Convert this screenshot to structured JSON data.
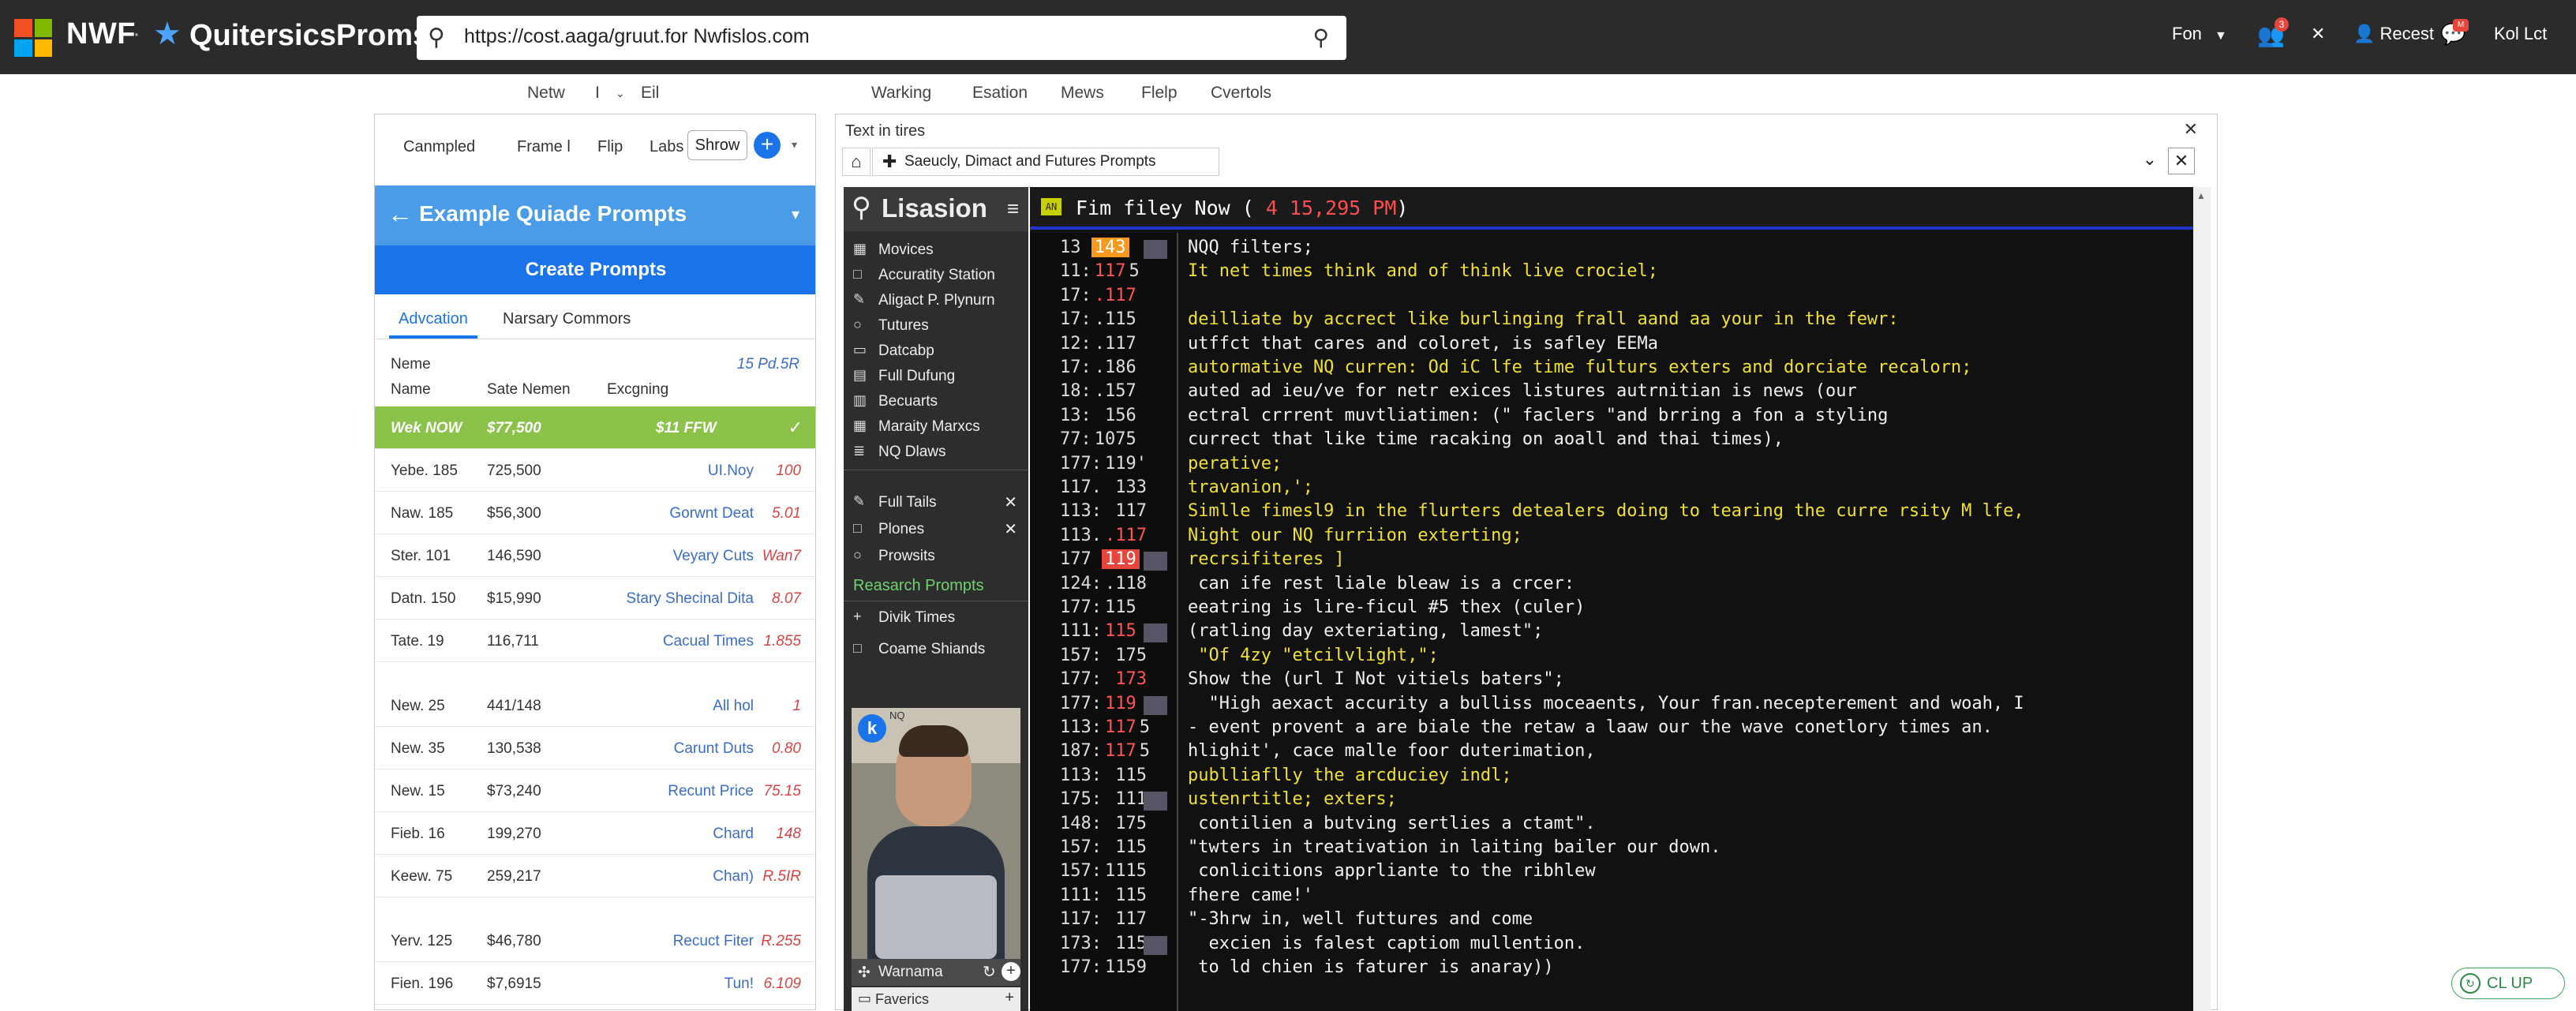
{
  "topbar": {
    "brand": "NWF",
    "separator": "·",
    "brand2": "QuitersicsProms",
    "url": "https://cost.aaga/gruut.for Nwfislos.com",
    "right_menu": "Fon",
    "notif_count": "3",
    "recent_label": "Recest",
    "msg_badge": "M",
    "user": "Kol Lct"
  },
  "navrow": {
    "left_items": [
      "Netw",
      "I",
      "Eil"
    ],
    "items": [
      "Warking",
      "Esation",
      "Mews",
      "Flelp",
      "Cvertols"
    ]
  },
  "left_panel": {
    "tools": [
      "Canmpled",
      "Frame l",
      "Flip",
      "Labs"
    ],
    "show_button": "Shrow",
    "header_title": "Example Quiade Prompts",
    "create_button": "Create Prompts",
    "tabs": [
      "Advcation",
      "Narsary Commors"
    ],
    "meta_label": "Neme",
    "meta_value": "15 Pd.5R",
    "columns": [
      "Name",
      "Sate Nemen",
      "Excgning"
    ],
    "highlight_row": {
      "c1": "Wek NOW",
      "c2": "$77,500",
      "c3": "$11 FFW"
    },
    "rows": [
      {
        "c1": "Yebe. 185",
        "c2": "725,500",
        "c3": "UI.Noy",
        "c4": "100"
      },
      {
        "c1": "Naw. 185",
        "c2": "$56,300",
        "c3": "Gorwnt Deat",
        "c4": "5.01"
      },
      {
        "c1": "Ster. 101",
        "c2": "146,590",
        "c3": "Veyary Cuts",
        "c4": "Wan7"
      },
      {
        "c1": "Datn. 150",
        "c2": "$15,990",
        "c3": "Stary Shecinal Dita",
        "c4": "8.07"
      },
      {
        "c1": "Tate. 19",
        "c2": "116,711",
        "c3": "Cacual Times",
        "c4": "1.855"
      },
      {
        "c1": "New. 25",
        "c2": "441/148",
        "c3": "All hol",
        "c4": "1"
      },
      {
        "c1": "New. 35",
        "c2": "130,538",
        "c3": "Carunt Duts",
        "c4": "0.80"
      },
      {
        "c1": "New. 15",
        "c2": "$73,240",
        "c3": "Recunt Price",
        "c4": "75.15"
      },
      {
        "c1": "Fieb. 16",
        "c2": "199,270",
        "c3": "Chard",
        "c4": "148"
      },
      {
        "c1": "Keew. 75",
        "c2": "259,217",
        "c3": "Chan)",
        "c4": "R.5IR"
      },
      {
        "c1": "Yerv. 125",
        "c2": "$46,780",
        "c3": "Recuct Fiter",
        "c4": "R.255"
      },
      {
        "c1": "Fien. 196",
        "c2": "$7,6915",
        "c3": "Tun!",
        "c4": "6.109"
      }
    ]
  },
  "right_window": {
    "title": "Text in tires",
    "tab_label": "Saeucly, Dimact and Futures  Prompts",
    "sidebar": {
      "title": "Lisasion",
      "items": [
        {
          "icon": "monitor-icon",
          "glyph": "▦",
          "label": "Movices"
        },
        {
          "icon": "box-icon",
          "glyph": "□",
          "label": "Accuratity Station"
        },
        {
          "icon": "pen-icon",
          "glyph": "✎",
          "label": "Aligact P. Plynurn"
        },
        {
          "icon": "circle-icon",
          "glyph": "○",
          "label": "Tutures"
        },
        {
          "icon": "clip-icon",
          "glyph": "▭",
          "label": "Datcabp"
        },
        {
          "icon": "film-icon",
          "glyph": "▤",
          "label": "Full Dufung"
        },
        {
          "icon": "doc-icon",
          "glyph": "▥",
          "label": "Becuarts"
        },
        {
          "icon": "grid-icon",
          "glyph": "▦",
          "label": "Maraity Marxcs"
        },
        {
          "icon": "list-icon",
          "glyph": "≣",
          "label": "NQ Dlaws"
        }
      ],
      "items2": [
        {
          "icon": "pen-icon",
          "glyph": "✎",
          "label": "Full Tails",
          "closable": true
        },
        {
          "icon": "box-icon",
          "glyph": "□",
          "label": "Plones",
          "closable": true
        },
        {
          "icon": "circle-icon",
          "glyph": "○",
          "label": "Prowsits",
          "closable": false
        }
      ],
      "section_label": "Reasarch Prompts",
      "items3": [
        {
          "icon": "plus-icon",
          "glyph": "+",
          "label": "Divik Times"
        },
        {
          "icon": "box-icon",
          "glyph": "□",
          "label": "Coame Shiands"
        }
      ],
      "video_badge": "k",
      "video_caption": "NQ",
      "bottom_label": "Warnama",
      "fav_label": "Faverics"
    },
    "terminal": {
      "title_main": "Fim filey Now ( ",
      "title_red": "4 15,295 PM",
      "title_end": ")",
      "lines": [
        {
          "n": "13 ",
          "tag": "143",
          "tagc": "orange",
          "code": "NQQ filters;",
          "y": false,
          "mark": true
        },
        {
          "n": "11:",
          "tag": "117",
          "tagc": "red",
          "tail": "5",
          "code": "It net times think and of think live crociel;",
          "y": true
        },
        {
          "n": "17:",
          "tag": ".117",
          "tagc": "red",
          "code": "",
          "y": false
        },
        {
          "n": "17:",
          "tag": ".115",
          "tagc": "",
          "code": "deilliate by accrect like burlinging frall aand aa your in the fewr:",
          "y": true
        },
        {
          "n": "12:",
          "tag": ".117",
          "tagc": "",
          "code": "utffct that cares and coloret, is safley EEMa",
          "y": false
        },
        {
          "n": "17:",
          "tag": ".186",
          "tagc": "",
          "code": "autormative NQ curren: Od iC lfe time fulturs exters and dorciate recalorn;",
          "y": true
        },
        {
          "n": "18:",
          "tag": ".157",
          "tagc": "",
          "code": "auted ad ieu/ve for netr exices listures autrnitian is news (our",
          "y": false
        },
        {
          "n": "13:",
          "tag": " 156",
          "tagc": "",
          "code": "ectral crrrent muvtliatimen: (\" faclers \"and brring a fon a styling",
          "y": false
        },
        {
          "n": "77:",
          "tag": "1075",
          "tagc": "",
          "code": "currect that like time racaking on aoall and thai times),",
          "y": false
        },
        {
          "n": "177:",
          "tag": "119'",
          "tagc": "",
          "code": "perative;",
          "y": true
        },
        {
          "n": "117.",
          "tag": " 133",
          "tagc": "",
          "code": "travanion,';",
          "y": true
        },
        {
          "n": "113:",
          "tag": " 117",
          "tagc": "",
          "code": "Simlle fimesl9 in the flurters detealers doing to tearing the curre rsity M lfe,",
          "y": true
        },
        {
          "n": "113.",
          "tag": ".117",
          "tagc": "red",
          "code": "Night our NQ furriion exterting;",
          "y": true
        },
        {
          "n": "177 ",
          "tag": "119",
          "tagc": "redbg",
          "code": "recrsifiteres ]",
          "y": true,
          "mark": true
        },
        {
          "n": "124:",
          "tag": ".118",
          "tagc": "",
          "code": " can ife rest liale bleaw is a crcer:",
          "y": false
        },
        {
          "n": "177:",
          "tag": "115",
          "tagc": "",
          "code": "eeatring is lire-ficul #5 thex (culer)",
          "y": false
        },
        {
          "n": "111:",
          "tag": "115",
          "tagc": "red",
          "code": "(ratling day exteriating, lamest\";",
          "y": false,
          "mark": true
        },
        {
          "n": "157:",
          "tag": " 175",
          "tagc": "",
          "code": " \"Of 4zy \"etcilvlight,\";",
          "y": true
        },
        {
          "n": "177:",
          "tag": " 173",
          "tagc": "red",
          "code": "Show the (url I Not vitiels baters\";",
          "y": false
        },
        {
          "n": "177:",
          "tag": "119",
          "tagc": "red",
          "code": "  \"High aexact accurity a bulliss moceaents, Your fran.necepterement and woah, I",
          "y": false,
          "mark": true
        },
        {
          "n": "113:",
          "tag": "117",
          "tagc": "red",
          "tail": "5",
          "code": "- event provent a are biale the retaw a laaw our the wave conetlory times an.",
          "y": false
        },
        {
          "n": "187:",
          "tag": "117",
          "tagc": "red",
          "tail": "5",
          "code": "hlighit', cace malle foor duterimation,",
          "y": false
        },
        {
          "n": "113:",
          "tag": " 115",
          "tagc": "",
          "code": "publliaflly the arcduciey indl;",
          "y": true
        },
        {
          "n": "175:",
          "tag": " 111",
          "tagc": "",
          "code": "ustenrtitle; exters;",
          "y": true,
          "mark": true
        },
        {
          "n": "148:",
          "tag": " 175",
          "tagc": "",
          "code": " contilien a butving sertlies a ctamt\".",
          "y": false
        },
        {
          "n": "157:",
          "tag": " 115",
          "tagc": "",
          "code": "\"twters in treativation in laiting bailer our down.",
          "y": false
        },
        {
          "n": "157:",
          "tag": "1115",
          "tagc": "",
          "code": " conlicitions apprliante to the ribhlew",
          "y": false
        },
        {
          "n": "111:",
          "tag": " 115",
          "tagc": "",
          "code": "fhere came!'",
          "y": false
        },
        {
          "n": "117:",
          "tag": " 117",
          "tagc": "",
          "code": "\"-3hrw in, well futtures and come",
          "y": false
        },
        {
          "n": "173:",
          "tag": " 115",
          "tagc": "",
          "code": "  excien is falest captiom mullention.",
          "y": false,
          "mark": true
        },
        {
          "n": "177:",
          "tag": "1159",
          "tagc": "",
          "code": " to ld chien is faturer is anaray))",
          "y": false
        }
      ]
    }
  },
  "chip": {
    "label": "CL UP"
  },
  "colors": {
    "accent": "#1a73e8",
    "highlight": "#8bc34a",
    "terminal_bg": "#111111",
    "code_yellow": "#f0e030"
  }
}
